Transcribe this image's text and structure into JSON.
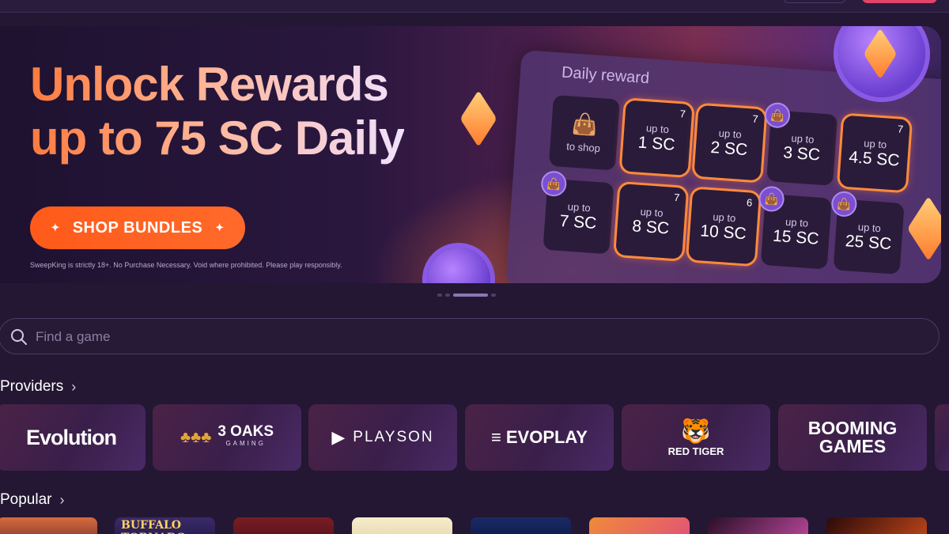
{
  "banner": {
    "headline_line1": "Unlock Rewards",
    "headline_line2": "up to 75 SC Daily",
    "cta_label": "SHOP BUNDLES",
    "disclaimer": "SweepKing is strictly 18+. No Purchase Necessary. Void where prohibited. Please play responsibly."
  },
  "daily_reward": {
    "title": "Daily reward",
    "shop_tile": "to shop",
    "tiles": [
      {
        "up": "up to",
        "amount": "1 SC",
        "count": "7"
      },
      {
        "up": "up to",
        "amount": "2 SC",
        "count": "7"
      },
      {
        "up": "up to",
        "amount": "3 SC",
        "count": ""
      },
      {
        "up": "up to",
        "amount": "4.5 SC",
        "count": "7"
      },
      {
        "up": "up to",
        "amount": "7 SC",
        "count": ""
      },
      {
        "up": "up to",
        "amount": "8 SC",
        "count": "7"
      },
      {
        "up": "up to",
        "amount": "10 SC",
        "count": "6"
      },
      {
        "up": "up to",
        "amount": "15 SC",
        "count": ""
      },
      {
        "up": "up to",
        "amount": "25 SC",
        "count": ""
      }
    ]
  },
  "search": {
    "placeholder": "Find a game"
  },
  "providers": {
    "title": "Providers",
    "items": [
      "Evolution",
      "3 OAKS",
      "GAMING",
      "PLAYSON",
      "EVOPLAY",
      "RED TIGER",
      "BOOMING",
      "GAMES"
    ]
  },
  "popular": {
    "title": "Popular",
    "games": [
      "BUFFALO TORNADO"
    ]
  },
  "colors": {
    "accent": "#ff5a1a",
    "background": "#231733"
  }
}
